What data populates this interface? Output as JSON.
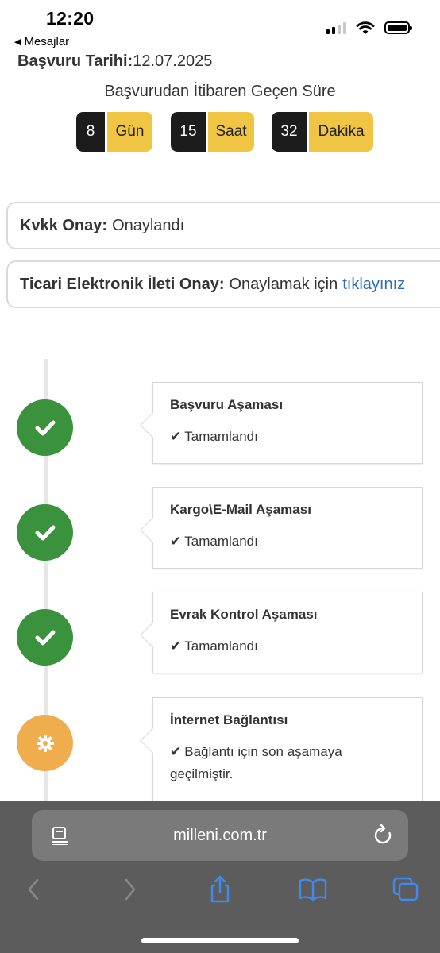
{
  "status_bar": {
    "time": "12:20",
    "back_app": "Mesajlar"
  },
  "application": {
    "date_label": "Başvuru Tarihi:",
    "date_value": "12.07.2025"
  },
  "elapsed": {
    "title": "Başvurudan İtibaren Geçen Süre",
    "days": {
      "value": "8",
      "unit": "Gün"
    },
    "hours": {
      "value": "15",
      "unit": "Saat"
    },
    "minutes": {
      "value": "32",
      "unit": "Dakika"
    }
  },
  "consents": {
    "kvkk": {
      "label": "Kvkk Onay:",
      "value": "Onaylandı"
    },
    "commercial": {
      "label": "Ticari Elektronik İleti Onay:",
      "value": "Onaylamak için",
      "link": "tıklayınız"
    }
  },
  "steps": [
    {
      "title": "Başvuru Aşaması",
      "status": "Tamamlandı",
      "state": "done"
    },
    {
      "title": "Kargo\\E-Mail Aşaması",
      "status": "Tamamlandı",
      "state": "done"
    },
    {
      "title": "Evrak Kontrol Aşaması",
      "status": "Tamamlandı",
      "state": "done"
    },
    {
      "title": "İnternet Bağlantısı",
      "status": "Bağlantı için son aşamaya geçilmiştir.",
      "state": "current"
    }
  ],
  "browser": {
    "url": "milleni.com.tr"
  },
  "colors": {
    "done": "#3a923d",
    "current": "#f0ad4e",
    "accent": "#f0c544",
    "dark": "#1c1c1c",
    "link": "#2c6db4",
    "browser_chrome": "#5c5c5c"
  },
  "icons": [
    "back-triangle-icon",
    "signal-icon",
    "wifi-icon",
    "battery-icon",
    "check-icon",
    "gear-icon",
    "reader-icon",
    "reload-icon",
    "back-icon",
    "forward-icon",
    "share-icon",
    "bookmarks-icon",
    "tabs-icon"
  ]
}
